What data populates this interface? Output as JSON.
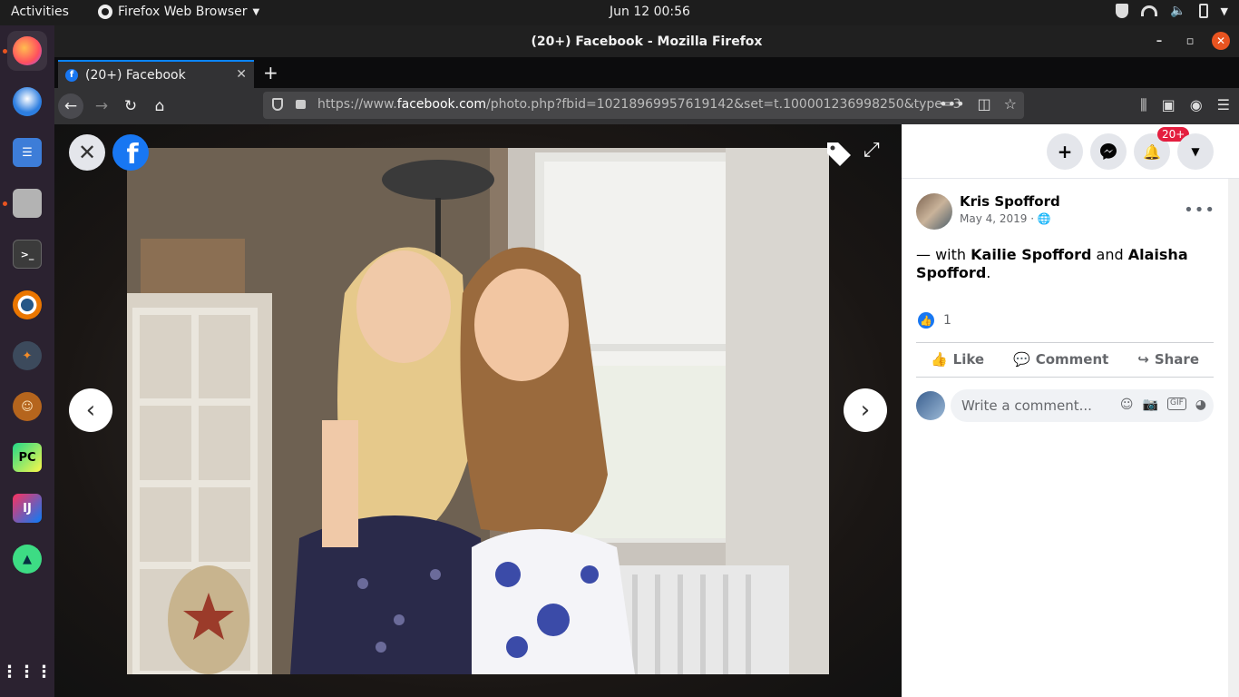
{
  "topbar": {
    "activities": "Activities",
    "app_name": "Firefox Web Browser",
    "clock": "Jun 12  00:56"
  },
  "dock": {
    "items": [
      "firefox",
      "thunderbird",
      "todo",
      "files",
      "terminal",
      "blender",
      "inkscape",
      "monkey-app",
      "pycharm",
      "intellij",
      "android-studio",
      "show-apps"
    ]
  },
  "window": {
    "title": "(20+) Facebook - Mozilla Firefox"
  },
  "tab": {
    "label": "(20+) Facebook"
  },
  "urlbar": {
    "prefix": "https://www.",
    "domain": "facebook.com",
    "path": "/photo.php?fbid=10218969957619142&set=t.100001236998250&type=3"
  },
  "panel": {
    "notification_count": "20+",
    "author": "Kris Spofford",
    "date": "May 4, 2019 · ",
    "caption_prefix": "— with ",
    "tagged_1": "Kailie Spofford",
    "caption_and": " and ",
    "tagged_2": "Alaisha Spofford",
    "caption_suffix": ".",
    "like_count": "1",
    "actions": {
      "like": "Like",
      "comment": "Comment",
      "share": "Share"
    },
    "comment_placeholder": "Write a comment..."
  },
  "colors": {
    "facebook_blue": "#1877f2",
    "ubuntu_orange": "#e95420",
    "notification_red": "#e41e3f"
  }
}
